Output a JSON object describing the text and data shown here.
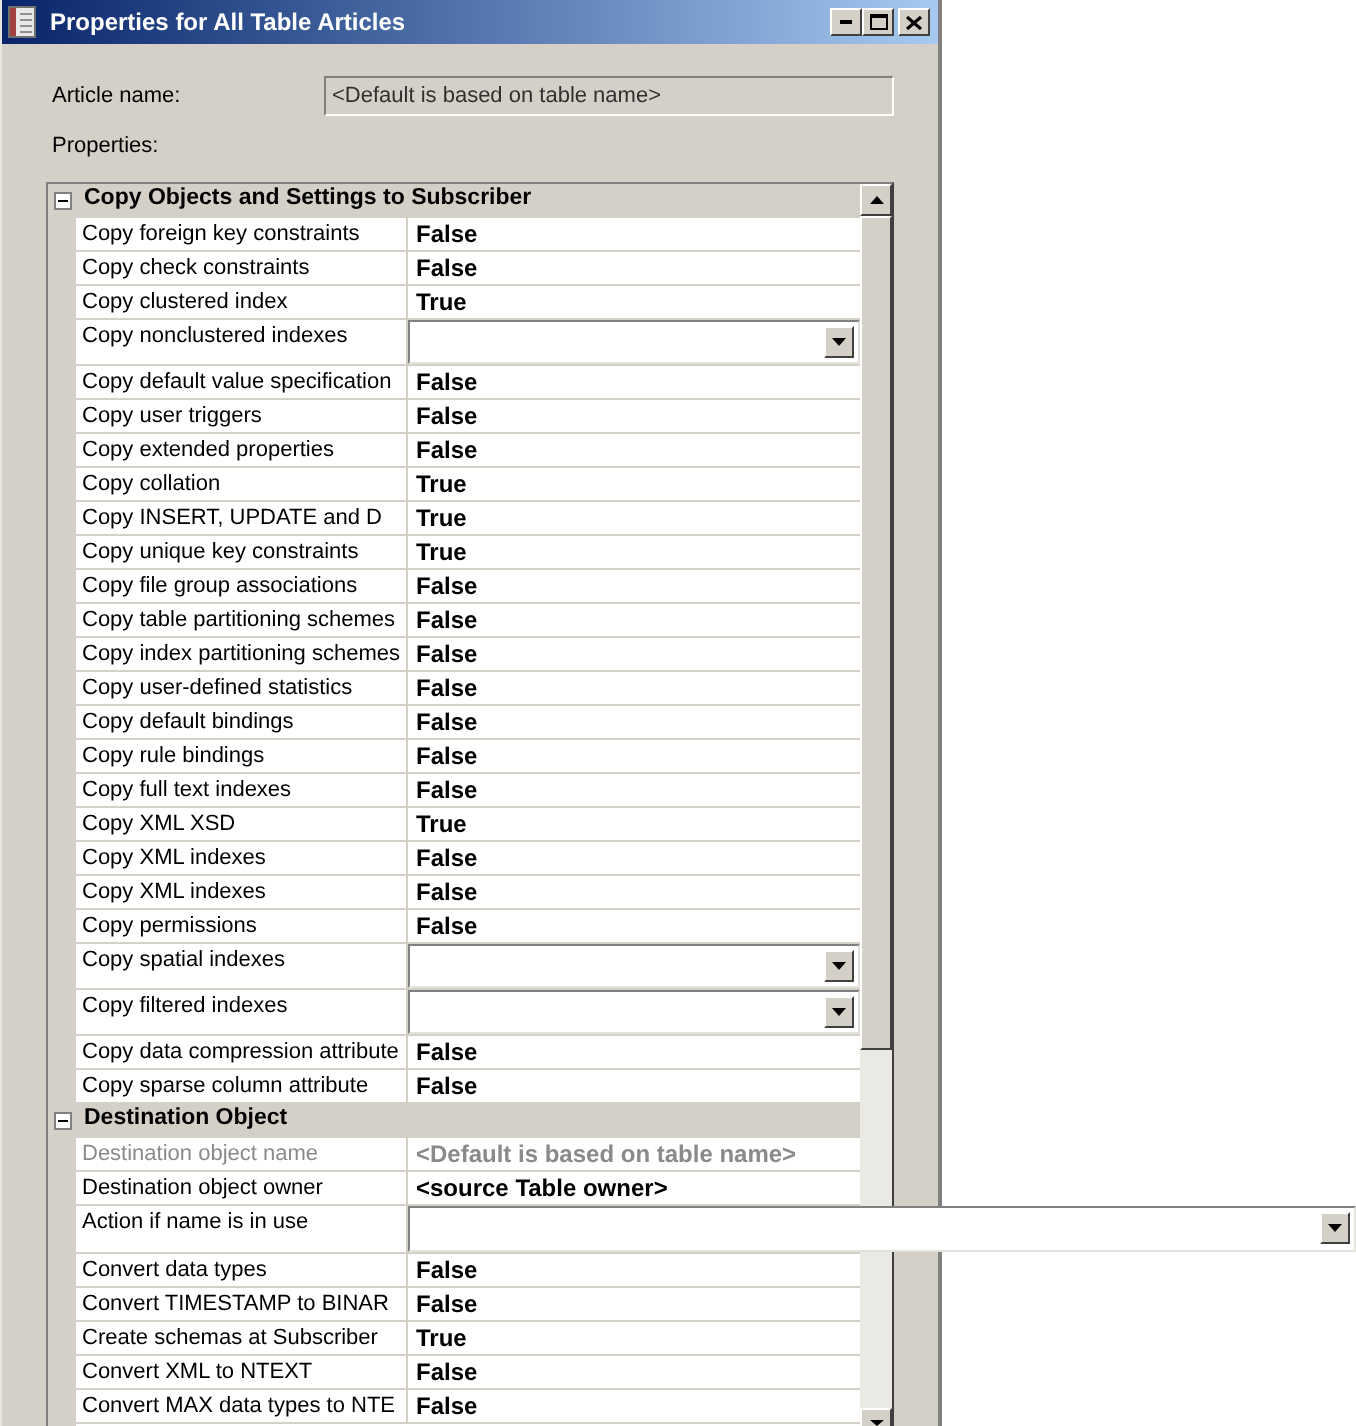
{
  "window": {
    "title": "Properties for All Table Articles"
  },
  "article_name": {
    "label": "Article name:",
    "value": "<Default is based on table name>",
    "disabled": true
  },
  "properties_label": {
    "label": "Properties:"
  },
  "categories": [
    {
      "title": "Copy Objects and Settings to Subscriber",
      "expanded": true,
      "properties": [
        {
          "name": "Copy foreign key constraints",
          "kind": "value",
          "value": "False"
        },
        {
          "name": "Copy check constraints",
          "kind": "value",
          "value": "False"
        },
        {
          "name": "Copy clustered index",
          "kind": "value",
          "value": "True"
        },
        {
          "name": "Copy nonclustered indexes",
          "kind": "dropdown",
          "active": false
        },
        {
          "name": "Copy default value specification",
          "kind": "value",
          "value": "False"
        },
        {
          "name": "Copy user triggers",
          "kind": "value",
          "value": "False"
        },
        {
          "name": "Copy extended properties",
          "kind": "value",
          "value": "False"
        },
        {
          "name": "Copy collation",
          "kind": "value",
          "value": "True"
        },
        {
          "name": "Copy INSERT, UPDATE and D",
          "kind": "value",
          "value": "True"
        },
        {
          "name": "Copy unique key constraints",
          "kind": "value",
          "value": "True"
        },
        {
          "name": "Copy file group associations",
          "kind": "value",
          "value": "False"
        },
        {
          "name": "Copy table partitioning schemes",
          "kind": "value",
          "value": "False"
        },
        {
          "name": "Copy index partitioning schemes",
          "kind": "value",
          "value": "False"
        },
        {
          "name": "Copy user-defined statistics",
          "kind": "value",
          "value": "False"
        },
        {
          "name": "Copy default bindings",
          "kind": "value",
          "value": "False"
        },
        {
          "name": "Copy rule bindings",
          "kind": "value",
          "value": "False"
        },
        {
          "name": "Copy full text indexes",
          "kind": "value",
          "value": "False"
        },
        {
          "name": "Copy XML XSD",
          "kind": "value",
          "value": "True"
        },
        {
          "name": "Copy XML indexes",
          "kind": "value",
          "value": "False"
        },
        {
          "name": "Copy XML indexes",
          "kind": "value",
          "value": "False"
        },
        {
          "name": "Copy permissions",
          "kind": "value",
          "value": "False"
        },
        {
          "name": "Copy spatial indexes",
          "kind": "dropdown",
          "active": false
        },
        {
          "name": "Copy filtered indexes",
          "kind": "dropdown",
          "active": false
        },
        {
          "name": "Copy data compression attribute",
          "kind": "value",
          "value": "False"
        },
        {
          "name": "Copy sparse column attribute",
          "kind": "value",
          "value": "False"
        }
      ]
    },
    {
      "title": "Destination Object",
      "expanded": true,
      "properties": [
        {
          "name": "Destination object name",
          "kind": "readonly",
          "value": "<Default is based on table name>"
        },
        {
          "name": "Destination object owner",
          "kind": "value",
          "value": "<source Table owner>"
        },
        {
          "name": "Action if name is in use",
          "kind": "dropdown",
          "active": true
        },
        {
          "name": "Convert data types",
          "kind": "value",
          "value": "False"
        },
        {
          "name": "Convert TIMESTAMP to BINAR",
          "kind": "value",
          "value": "False"
        },
        {
          "name": "Create schemas at Subscriber",
          "kind": "value",
          "value": "True"
        },
        {
          "name": "Convert XML to NTEXT",
          "kind": "value",
          "value": "False"
        },
        {
          "name": "Convert MAX data types to NTE",
          "kind": "value",
          "value": "False"
        }
      ]
    }
  ]
}
